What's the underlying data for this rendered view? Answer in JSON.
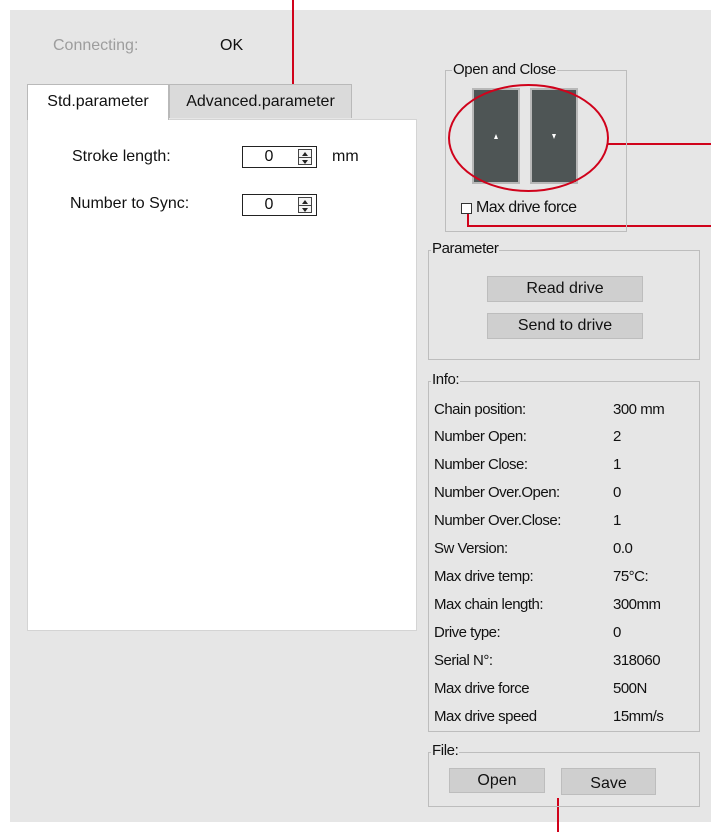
{
  "status": {
    "label": "Connecting:",
    "value": "OK"
  },
  "tabs": [
    {
      "label": "Std.parameter",
      "active": true
    },
    {
      "label": "Advanced.parameter",
      "active": false
    }
  ],
  "std_params": {
    "stroke_length": {
      "label": "Stroke length:",
      "value": "0",
      "unit": "mm"
    },
    "number_to_sync": {
      "label": "Number to Sync:",
      "value": "0"
    }
  },
  "open_close": {
    "title": "Open and Close",
    "up_icon": "arrow-up-icon",
    "down_icon": "arrow-down-icon",
    "max_drive_force_label": "Max drive force",
    "max_drive_force_checked": false
  },
  "parameter": {
    "title": "Parameter",
    "read_label": "Read drive",
    "send_label": "Send to drive"
  },
  "info": {
    "title": "Info:",
    "rows": [
      {
        "label": "Chain position:",
        "value": "300 mm"
      },
      {
        "label": "Number Open:",
        "value": "2"
      },
      {
        "label": "Number Close:",
        "value": "1"
      },
      {
        "label": "Number Over.Open:",
        "value": "0"
      },
      {
        "label": "Number Over.Close:",
        "value": "1"
      },
      {
        "label": "Sw Version:",
        "value": "0.0"
      },
      {
        "label": "Max drive temp:",
        "value": "75°C:"
      },
      {
        "label": "Max chain length:",
        "value": "300mm"
      },
      {
        "label": "Drive type:",
        "value": "0"
      },
      {
        "label": "Serial N°:",
        "value": "318060"
      },
      {
        "label": "Max drive force",
        "value": "500N"
      },
      {
        "label": "Max drive speed",
        "value": "15mm/s"
      }
    ]
  },
  "file": {
    "title": "File:",
    "open_label": "Open",
    "save_label": "Save"
  },
  "colors": {
    "panel_bg": "#e6e6e6",
    "callout_red": "#d0021b",
    "motor_button": "#4e5555",
    "muted_text": "#9d9d9d"
  }
}
